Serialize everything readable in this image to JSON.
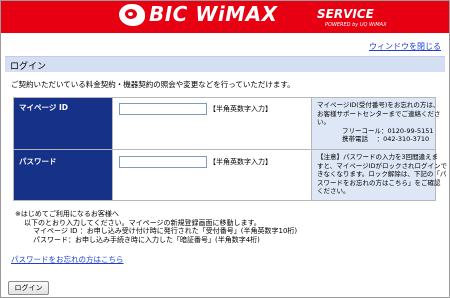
{
  "header": {
    "logo_main": "BIC WiMAX",
    "logo_service": "SERVICE",
    "logo_powered": "POWERED by UQ WiMAX",
    "close_window_link": "ウィンドウを閉じる",
    "brand_color": "#e60012"
  },
  "section": {
    "title": "ログイン",
    "intro": "ご契約いただいている料金契約・機器契約の照会や変更などを行っていただけます。"
  },
  "form": {
    "mypage_id": {
      "label": "マイページ ID",
      "value": "",
      "hint": "【半角英数字入力】",
      "info": [
        "マイページID(受付番号)をお忘れの方は、",
        "お客様サポートセンターまでご連絡くださ",
        "い。",
        "フリーコール：0120-99-5151",
        "携帯電話　 ：042-310-3710"
      ]
    },
    "password": {
      "label": "パスワード",
      "value": "",
      "hint": "【半角英数字入力】",
      "info": [
        "【注意】パスワードの入力を3回間違えま",
        "すと、マイページIDがロックされログインで",
        "きなくなります。ロック解除は、下記の「パ",
        "スワードをお忘れの方はこちら」をご確認",
        "ください。"
      ]
    }
  },
  "notes": [
    "※はじめてご利用になるお客様へ",
    "以下のとおり入力してください。マイページの新規登録画面に移動します。",
    "マイページ ID ：お申し込み受け付け時に発行された「受付番号」(半角英数字10桁)",
    "パスワード：お申し込み手続き時に入力した「暗証番号」(半角数字4桁)"
  ],
  "forgot_password_link": "パスワードをお忘れの方はこちら",
  "login_button": "ログイン"
}
